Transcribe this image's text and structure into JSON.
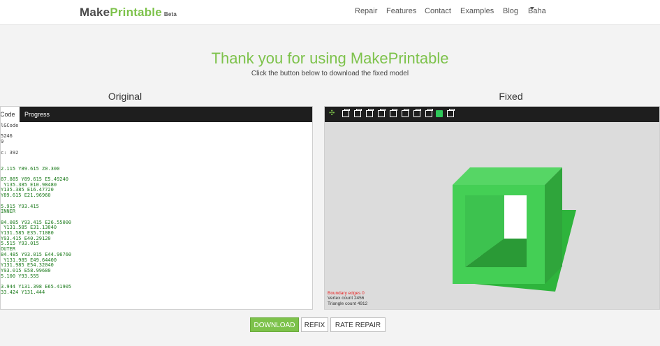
{
  "brand": {
    "part1": "Make",
    "part2": "Printable",
    "beta": "Beta"
  },
  "nav": {
    "items": [
      "Repair",
      "Features",
      "Contact",
      "Examples",
      "Blog",
      "Baha"
    ]
  },
  "hero": {
    "title": "Thank you for using MakePrintable",
    "subtitle": "Click the button below to download the fixed model"
  },
  "original": {
    "title": "Original",
    "tabs": [
      "Code",
      "Progress"
    ],
    "code_lines": [
      "lGCode",
      "",
      "5246",
      "9",
      "",
      "c: 392",
      "",
      "",
      "2.115 Y89.615 Z0.300",
      "",
      "87.885 Y89.615 E5.49240",
      " Y135.385 E10.98480",
      "Y135.385 E16.47720",
      "Y89.615 E21.96960",
      "",
      "5.915 Y93.415",
      "INNER",
      "",
      "84.085 Y93.415 E26.55000",
      " Y131.585 E31.13040",
      "Y131.585 E35.71080",
      "Y93.415 E40.29120",
      "5.515 Y93.015",
      "OUTER",
      "84.485 Y93.015 E44.96760",
      " Y131.985 E49.64400",
      "Y131.985 E54.32040",
      "Y93.015 E58.99680",
      "5.100 Y93.555",
      "",
      "3.944 Y131.398 E65.41905",
      "33.424 Y131.444"
    ]
  },
  "fixed": {
    "title": "Fixed",
    "stats": {
      "boundary": "Boundary edges 0",
      "vertex": "Vertex count 2456",
      "triangle": "Triangle count 4912"
    },
    "model_colors": {
      "front": "#44cf55",
      "side": "#2fa53b",
      "top": "#56d665",
      "floor": "#2eb43c"
    }
  },
  "actions": {
    "download": "DOWNLOAD",
    "refix": "REFIX",
    "rate": "RATE REPAIR"
  }
}
